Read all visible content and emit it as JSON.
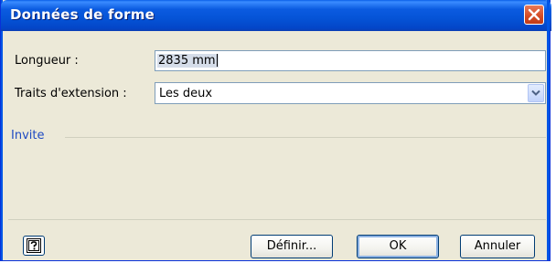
{
  "window": {
    "title": "Données de forme",
    "close_icon": "close-icon"
  },
  "form": {
    "length_label": "Longueur :",
    "length_value": "2835 mm",
    "extension_label": "Traits d'extension :",
    "extension_value": "Les deux",
    "dropdown_icon": "chevron-down-icon"
  },
  "prompt_group": {
    "title": "Invite"
  },
  "footer": {
    "help_icon": "help-icon",
    "define_label": "Définir...",
    "ok_label": "OK",
    "cancel_label": "Annuler"
  },
  "colors": {
    "titlebar": "#0553D6",
    "dialog_bg": "#ECE9D8",
    "group_title": "#1F4BC3",
    "close_button": "#D34A23"
  }
}
